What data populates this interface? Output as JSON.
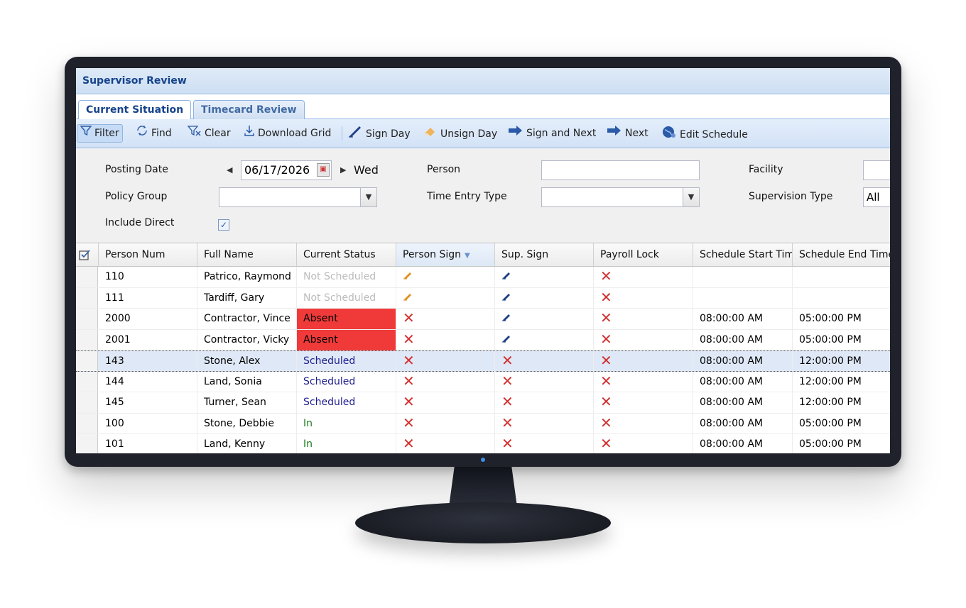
{
  "panel": {
    "title": "Supervisor Review"
  },
  "tabs": [
    {
      "label": "Current Situation",
      "active": true
    },
    {
      "label": "Timecard Review",
      "active": false
    }
  ],
  "toolbar": {
    "filter": "Filter",
    "find": "Find",
    "clear": "Clear",
    "download": "Download Grid",
    "sign_day": "Sign Day",
    "unsign_day": "Unsign Day",
    "sign_next": "Sign and Next",
    "next": "Next",
    "edit_schedule": "Edit Schedule"
  },
  "filters": {
    "posting_date_label": "Posting Date",
    "posting_date_value": "06/17/2026",
    "posting_day": "Wed",
    "person_label": "Person",
    "person_value": "",
    "facility_label": "Facility",
    "facility_value": "",
    "policy_group_label": "Policy Group",
    "policy_group_value": "",
    "time_entry_type_label": "Time Entry Type",
    "time_entry_type_value": "",
    "supervision_type_label": "Supervision Type",
    "supervision_type_value": "All",
    "include_direct_label": "Include Direct",
    "include_direct_checked": true
  },
  "grid": {
    "columns": [
      "Person Num",
      "Full Name",
      "Current Status",
      "Person Sign",
      "Sup. Sign",
      "Payroll Lock",
      "Schedule Start Time",
      "Schedule End Time"
    ],
    "rows": [
      {
        "num": "110",
        "name": "Patrico, Raymond",
        "status": "Not Scheduled",
        "status_type": "notsched",
        "person_sign": "pen-orange",
        "sup_sign": "pen-blue",
        "payroll_lock": "x",
        "start": "",
        "end": ""
      },
      {
        "num": "111",
        "name": "Tardiff, Gary",
        "status": "Not Scheduled",
        "status_type": "notsched",
        "person_sign": "pen-orange",
        "sup_sign": "pen-blue",
        "payroll_lock": "x",
        "start": "",
        "end": ""
      },
      {
        "num": "2000",
        "name": "Contractor, Vince",
        "status": "Absent",
        "status_type": "absent",
        "person_sign": "x",
        "sup_sign": "pen-blue",
        "payroll_lock": "x",
        "start": "08:00:00 AM",
        "end": "05:00:00 PM"
      },
      {
        "num": "2001",
        "name": "Contractor, Vicky",
        "status": "Absent",
        "status_type": "absent",
        "person_sign": "x",
        "sup_sign": "pen-blue",
        "payroll_lock": "x",
        "start": "08:00:00 AM",
        "end": "05:00:00 PM"
      },
      {
        "num": "143",
        "name": "Stone, Alex",
        "status": "Scheduled",
        "status_type": "sched",
        "person_sign": "x",
        "sup_sign": "x",
        "payroll_lock": "x",
        "start": "08:00:00 AM",
        "end": "12:00:00 PM",
        "selected": true
      },
      {
        "num": "144",
        "name": "Land, Sonia",
        "status": "Scheduled",
        "status_type": "sched",
        "person_sign": "x",
        "sup_sign": "x",
        "payroll_lock": "x",
        "start": "08:00:00 AM",
        "end": "12:00:00 PM"
      },
      {
        "num": "145",
        "name": "Turner, Sean",
        "status": "Scheduled",
        "status_type": "sched",
        "person_sign": "x",
        "sup_sign": "x",
        "payroll_lock": "x",
        "start": "08:00:00 AM",
        "end": "12:00:00 PM"
      },
      {
        "num": "100",
        "name": "Stone, Debbie",
        "status": "In",
        "status_type": "in",
        "person_sign": "x",
        "sup_sign": "x",
        "payroll_lock": "x",
        "start": "08:00:00 AM",
        "end": "05:00:00 PM"
      },
      {
        "num": "101",
        "name": "Land, Kenny",
        "status": "In",
        "status_type": "in",
        "person_sign": "x",
        "sup_sign": "x",
        "payroll_lock": "x",
        "start": "08:00:00 AM",
        "end": "05:00:00 PM"
      }
    ]
  },
  "colors": {
    "absent": "#f03a3a",
    "accent": "#15428b",
    "x_mark": "#d23030"
  }
}
